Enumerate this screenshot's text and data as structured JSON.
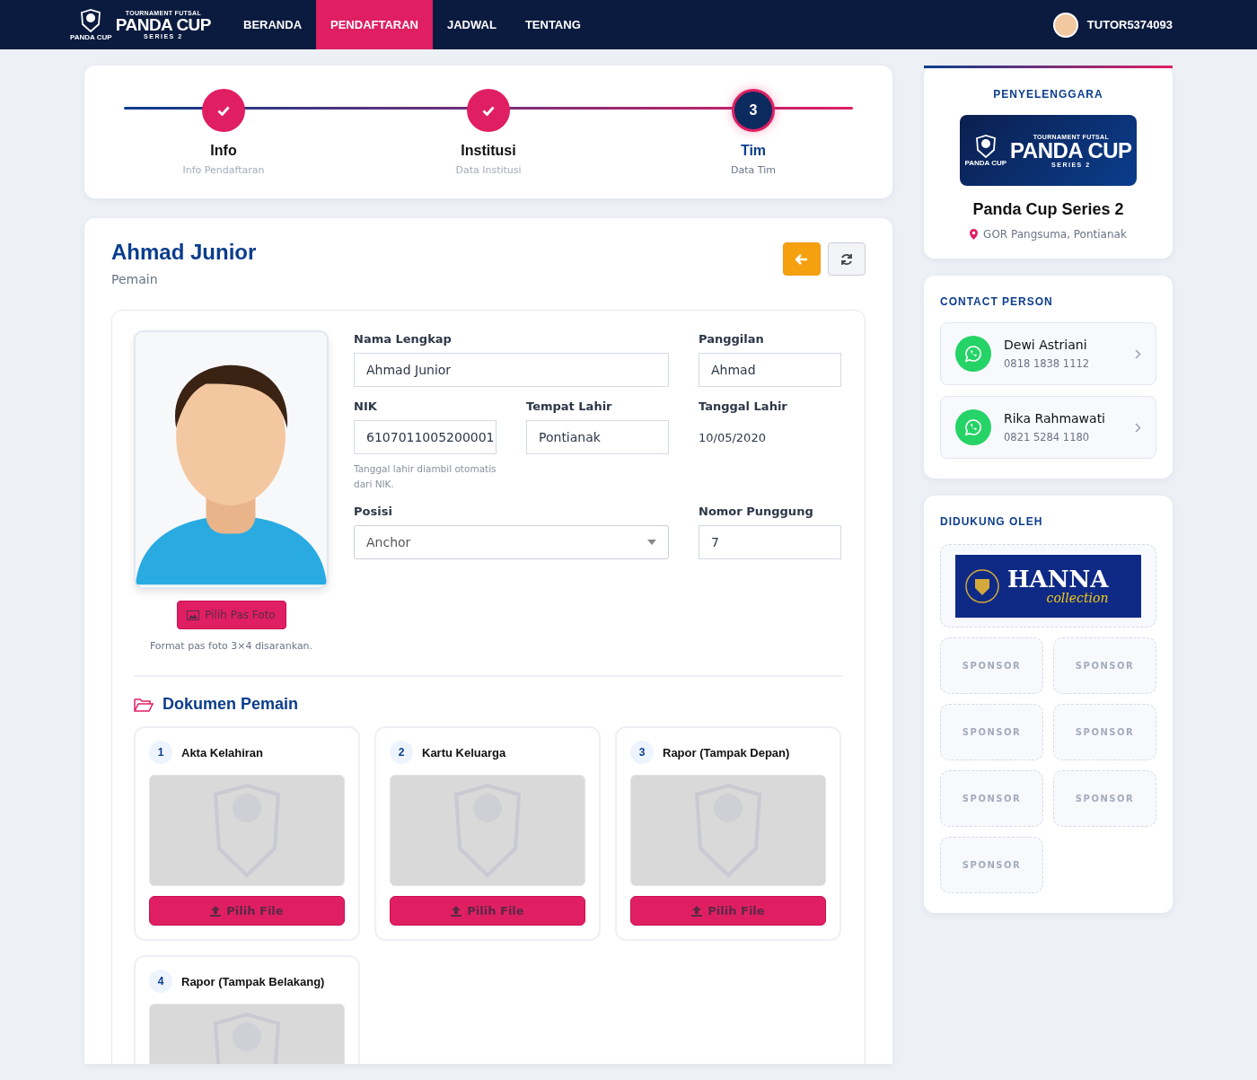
{
  "nav": {
    "logo": {
      "top": "TOURNAMENT FUTSAL",
      "badge": "PANDA CUP",
      "title": "PANDA CUP",
      "sub": "SERIES 2"
    },
    "links": [
      {
        "label": "BERANDA",
        "selected": false
      },
      {
        "label": "PENDAFTARAN",
        "selected": true
      },
      {
        "label": "JADWAL",
        "selected": false
      },
      {
        "label": "TENTANG",
        "selected": false
      }
    ],
    "user": "TUTOR5374093"
  },
  "stepper": [
    {
      "title": "Info",
      "subtitle": "Info Pendaftaran",
      "done": true,
      "selected": false
    },
    {
      "title": "Institusi",
      "subtitle": "Data Institusi",
      "done": true,
      "selected": false
    },
    {
      "title": "Tim",
      "subtitle": "Data Tim",
      "done": false,
      "selected": true,
      "number": "3"
    }
  ],
  "player": {
    "name": "Ahmad Junior",
    "role": "Pemain",
    "photo_button": "Pilih Pas Foto",
    "photo_hint": "Format pas foto 3×4 disarankan.",
    "rows": [
      [
        {
          "kind": "input",
          "label": "Nama Lengkap",
          "value": "Ahmad Junior"
        },
        {
          "kind": "input",
          "label": "Panggilan",
          "value": "Ahmad"
        }
      ],
      [
        {
          "kind": "input",
          "label": "NIK",
          "value": "6107011005200001",
          "hint": "Tanggal lahir diambil otomatis dari NIK."
        },
        {
          "kind": "input",
          "label": "Tempat Lahir",
          "value": "Pontianak"
        },
        {
          "kind": "static",
          "label": "Tanggal Lahir",
          "value": "10/05/2020"
        }
      ],
      [
        {
          "kind": "select",
          "label": "Posisi",
          "value": "Anchor"
        },
        {
          "kind": "input",
          "label": "Nomor Punggung",
          "value": "7"
        }
      ]
    ]
  },
  "documents": {
    "title": "Dokumen Pemain",
    "items": [
      {
        "number": "1",
        "title": "Akta Kelahiran",
        "button": "Pilih File"
      },
      {
        "number": "2",
        "title": "Kartu Keluarga",
        "button": "Pilih File"
      },
      {
        "number": "3",
        "title": "Rapor (Tampak Depan)",
        "button": "Pilih File"
      },
      {
        "number": "4",
        "title": "Rapor (Tampak Belakang)"
      }
    ]
  },
  "organizer": {
    "heading": "PENYELENGGARA",
    "logo": {
      "top": "TOURNAMENT FUTSAL",
      "badge": "PANDA CUP",
      "title": "PANDA CUP",
      "sub": "SERIES 2"
    },
    "name": "Panda Cup Series 2",
    "location": "GOR Pangsuma, Pontianak"
  },
  "contacts": {
    "heading": "CONTACT PERSON",
    "items": [
      {
        "name": "Dewi Astriani",
        "phone": "0818 1838 1112"
      },
      {
        "name": "Rika Rahmawati",
        "phone": "0821 5284 1180"
      }
    ]
  },
  "sponsors": {
    "heading": "DIDUKUNG OLEH",
    "featured": {
      "title": "HANNA",
      "subtitle": "collection"
    },
    "slots": [
      "SPONSOR",
      "SPONSOR",
      "SPONSOR",
      "SPONSOR",
      "SPONSOR",
      "SPONSOR",
      "SPONSOR"
    ]
  }
}
